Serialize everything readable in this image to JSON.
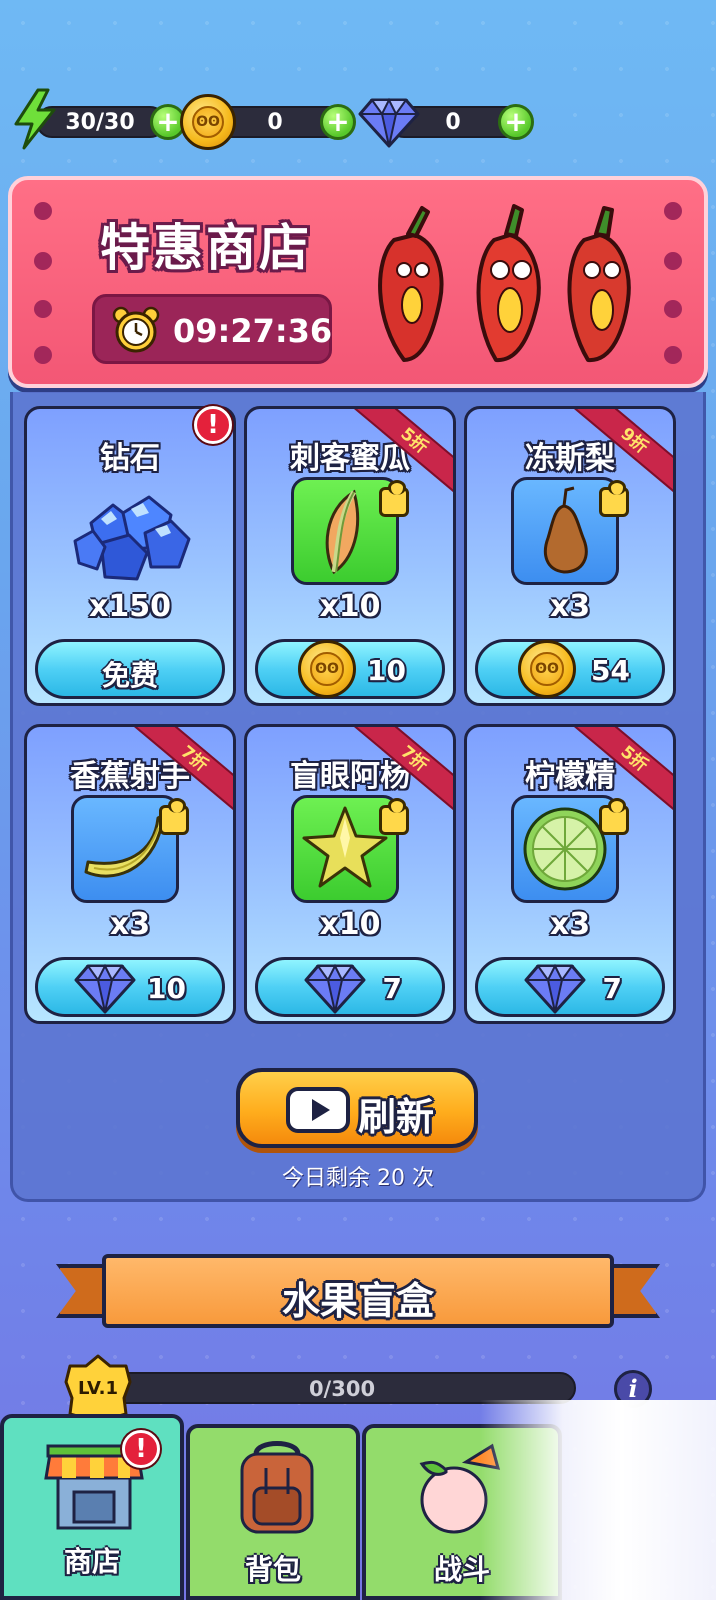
{
  "resources": {
    "energy": "30/30",
    "coins": "0",
    "gems": "0"
  },
  "banner": {
    "title": "特惠商店",
    "timer": "09:27:36"
  },
  "shop_items": [
    {
      "name": "钻石",
      "qty": "x150",
      "button_label": "免费",
      "currency": "free",
      "discount": "",
      "alert": true,
      "icon": "diamond-pile-icon"
    },
    {
      "name": "刺客蜜瓜",
      "qty": "x10",
      "price": "10",
      "currency": "coin",
      "discount": "5折",
      "icon": "melon-slice-icon"
    },
    {
      "name": "冻斯梨",
      "qty": "x3",
      "price": "54",
      "currency": "coin",
      "discount": "9折",
      "icon": "pear-icon"
    },
    {
      "name": "香蕉射手",
      "qty": "x3",
      "price": "10",
      "currency": "gem",
      "discount": "7折",
      "icon": "banana-icon"
    },
    {
      "name": "盲眼阿杨",
      "qty": "x10",
      "price": "7",
      "currency": "gem",
      "discount": "7折",
      "icon": "starfruit-icon"
    },
    {
      "name": "柠檬精",
      "qty": "x3",
      "price": "7",
      "currency": "gem",
      "discount": "5折",
      "icon": "lime-slice-icon"
    }
  ],
  "refresh": {
    "label": "刷新",
    "remaining": "今日剩余 20 次"
  },
  "blind_box": {
    "title": "水果盲盒"
  },
  "level": {
    "badge": "LV.1",
    "progress_text": "0/300",
    "progress_fraction": 0
  },
  "nav": [
    {
      "label": "商店",
      "active": true,
      "alert": true
    },
    {
      "label": "背包",
      "active": false
    },
    {
      "label": "战斗",
      "active": false
    }
  ],
  "colors": {
    "banner": "#f35775",
    "card_button": "#4fd0f5",
    "refresh_button": "#ffad1d",
    "nav_active": "#5fe0c0",
    "nav_inactive": "#93dc6b"
  }
}
